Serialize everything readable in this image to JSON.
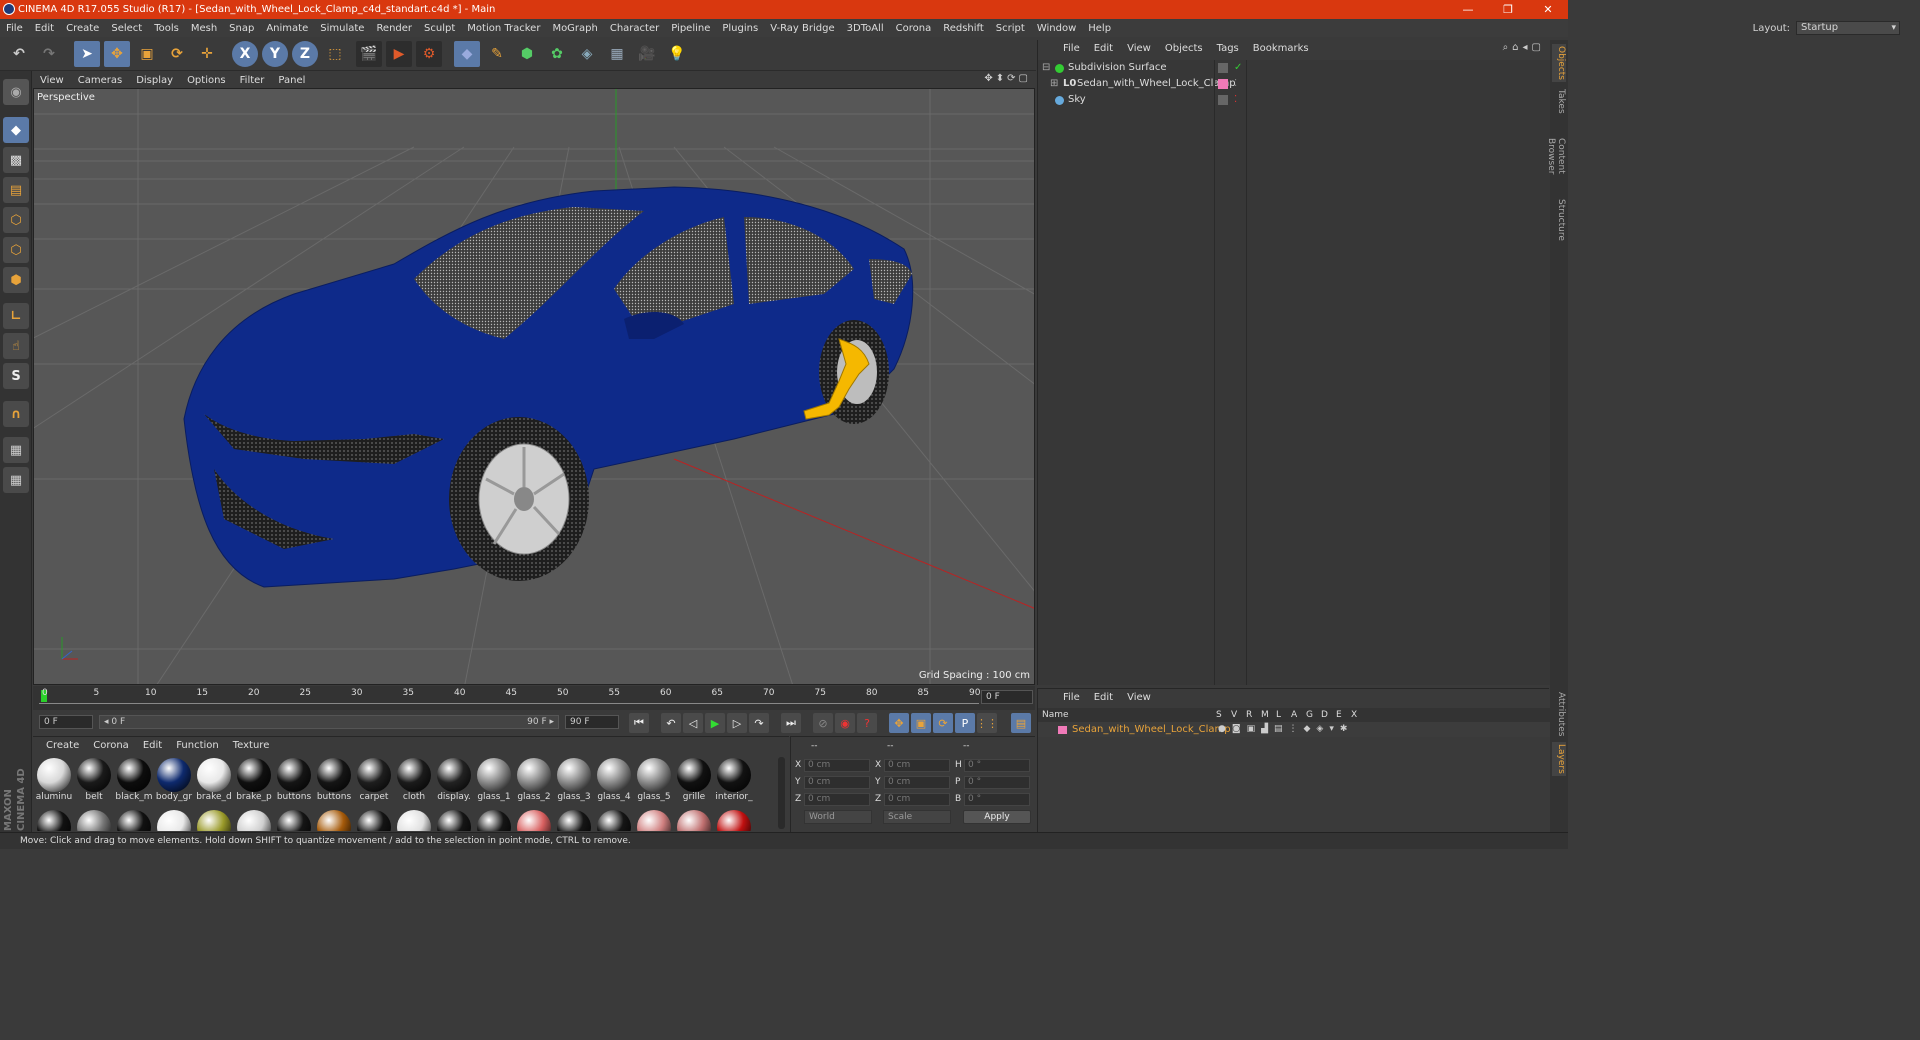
{
  "window": {
    "title": "CINEMA 4D R17.055 Studio (R17) - [Sedan_with_Wheel_Lock_Clamp_c4d_standart.c4d *] - Main",
    "controls": [
      "—",
      "❐",
      "✕"
    ]
  },
  "menubar": {
    "items": [
      "File",
      "Edit",
      "Create",
      "Select",
      "Tools",
      "Mesh",
      "Snap",
      "Animate",
      "Simulate",
      "Render",
      "Sculpt",
      "Motion Tracker",
      "MoGraph",
      "Character",
      "Pipeline",
      "Plugins",
      "V-Ray Bridge",
      "3DToAll",
      "Corona",
      "Redshift",
      "Script",
      "Window",
      "Help"
    ],
    "layout_label": "Layout:",
    "layout_value": "Startup"
  },
  "toolbar": {
    "axis_labels": [
      "X",
      "Y",
      "Z"
    ],
    "icons": [
      "undo-icon",
      "redo-icon",
      "select-arrow-icon",
      "move-icon",
      "scale-icon",
      "rotate-icon",
      "live-select-icon",
      "x-axis-icon",
      "y-axis-icon",
      "z-axis-icon",
      "world-coord-icon",
      "render-view-icon",
      "render-active-icon",
      "render-settings-icon",
      "cube-icon",
      "pen-spline-icon",
      "subdivision-icon",
      "cloner-icon",
      "deformer-icon",
      "floor-icon",
      "camera-icon",
      "light-icon"
    ]
  },
  "viewport": {
    "menu": [
      "View",
      "Cameras",
      "Display",
      "Options",
      "Filter",
      "Panel"
    ],
    "label": "Perspective",
    "grid_spacing": "Grid Spacing : 100 cm"
  },
  "timeline": {
    "ticks": [
      "0",
      "5",
      "10",
      "15",
      "20",
      "25",
      "30",
      "35",
      "40",
      "45",
      "50",
      "55",
      "60",
      "65",
      "70",
      "75",
      "80",
      "85",
      "90"
    ],
    "current_frame": "0 F",
    "start_field": "0 F",
    "range_start": "◂ 0 F",
    "range_end": "90 F ▸",
    "end_field": "90 F"
  },
  "materials": {
    "menu": [
      "Create",
      "Corona",
      "Edit",
      "Function",
      "Texture"
    ],
    "row1": [
      {
        "name": "aluminu",
        "color": "#d8d8d8"
      },
      {
        "name": "belt",
        "color": "#1a1a1a"
      },
      {
        "name": "black_m",
        "color": "#0d0d0d"
      },
      {
        "name": "body_gr",
        "color": "#0e2a6e"
      },
      {
        "name": "brake_d",
        "color": "#e8e8e8"
      },
      {
        "name": "brake_p",
        "color": "#101010"
      },
      {
        "name": "buttons",
        "color": "#151515"
      },
      {
        "name": "buttons",
        "color": "#151515"
      },
      {
        "name": "carpet",
        "color": "#1e1e1e"
      },
      {
        "name": "cloth",
        "color": "#1b1b1b"
      },
      {
        "name": "display.",
        "color": "#222222"
      },
      {
        "name": "glass_1",
        "color": "#8a8a8a"
      },
      {
        "name": "glass_2",
        "color": "#8a8a8a"
      },
      {
        "name": "glass_3",
        "color": "#8a8a8a"
      },
      {
        "name": "glass_4",
        "color": "#8a8a8a"
      },
      {
        "name": "glass_5",
        "color": "#8a8a8a"
      },
      {
        "name": "grille",
        "color": "#111111"
      },
      {
        "name": "interior_",
        "color": "#121212"
      }
    ],
    "row2_colors": [
      "#111111",
      "#777777",
      "#111111",
      "#e8e8e8",
      "#9a9a2a",
      "#cfcfcf",
      "#151515",
      "#a55a0a",
      "#141414",
      "#e0e0e0",
      "#151515",
      "#151515",
      "#d86060",
      "#151515",
      "#151515",
      "#d08080",
      "#c07070",
      "#c01010"
    ]
  },
  "coords": {
    "header": [
      "--",
      "--",
      "--"
    ],
    "rows": [
      {
        "a": "X",
        "av": "0 cm",
        "b": "X",
        "bv": "0 cm",
        "c": "H",
        "cv": "0 °"
      },
      {
        "a": "Y",
        "av": "0 cm",
        "b": "Y",
        "bv": "0 cm",
        "c": "P",
        "cv": "0 °"
      },
      {
        "a": "Z",
        "av": "0 cm",
        "b": "Z",
        "bv": "0 cm",
        "c": "B",
        "cv": "0 °"
      }
    ],
    "mode": "World",
    "scale": "Scale",
    "apply": "Apply"
  },
  "objects_panel": {
    "menu": [
      "File",
      "Edit",
      "View",
      "Objects",
      "Tags",
      "Bookmarks"
    ],
    "items": [
      {
        "name": "Subdivision Surface",
        "indent": 0
      },
      {
        "name": "Sedan_with_Wheel_Lock_Clamp",
        "indent": 1
      },
      {
        "name": "Sky",
        "indent": 0
      }
    ]
  },
  "layers_panel": {
    "menu": [
      "File",
      "Edit",
      "View"
    ],
    "columns": [
      "Name",
      "S",
      "V",
      "R",
      "M",
      "L",
      "A",
      "G",
      "D",
      "E",
      "X"
    ],
    "layer_name": "Sedan_with_Wheel_Lock_Clamp"
  },
  "side_tabs": [
    "Objects",
    "Takes",
    "Content Browser",
    "Structure"
  ],
  "side_tabs_bottom": [
    "Attributes",
    "Layers"
  ],
  "brand": "MAXON CINEMA 4D",
  "status": "Move: Click and drag to move elements. Hold down SHIFT to quantize movement / add to the selection in point mode, CTRL to remove.",
  "colors": {
    "titlebar": "#d9380f",
    "accent": "#e8a33a",
    "selected_tool": "#5b7aa8",
    "car_body": "#0e2a8a",
    "clamp": "#f5b800"
  }
}
